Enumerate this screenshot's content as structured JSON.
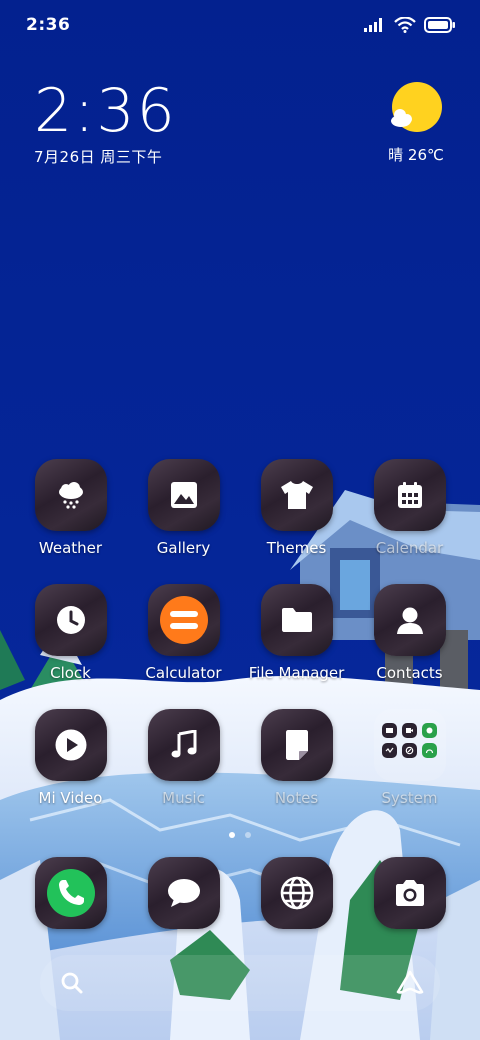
{
  "status_bar": {
    "time": "2:36",
    "icons": [
      "signal-icon",
      "wifi-icon",
      "battery-icon"
    ]
  },
  "clock_widget": {
    "time": "2:36",
    "date": "7月26日 周三下午"
  },
  "weather_widget": {
    "icon": "sun-cloud-icon",
    "text": "晴 26℃",
    "sun_color": "#ffd21f"
  },
  "apps": [
    {
      "label": "Weather",
      "icon": "weather-snow-icon"
    },
    {
      "label": "Gallery",
      "icon": "gallery-icon"
    },
    {
      "label": "Themes",
      "icon": "tshirt-icon"
    },
    {
      "label": "Calendar",
      "icon": "calendar-icon"
    },
    {
      "label": "Clock",
      "icon": "clock-icon"
    },
    {
      "label": "Calculator",
      "icon": "calculator-icon",
      "accent": "#ff7a1a"
    },
    {
      "label": "File Manager",
      "icon": "folder-icon"
    },
    {
      "label": "Contacts",
      "icon": "person-icon"
    },
    {
      "label": "Mi Video",
      "icon": "play-icon"
    },
    {
      "label": "Music",
      "icon": "music-note-icon"
    },
    {
      "label": "Notes",
      "icon": "note-icon"
    },
    {
      "label": "System",
      "icon": "folder-system-icon"
    }
  ],
  "pager": {
    "pages": 2,
    "current": 1
  },
  "dock": [
    {
      "icon": "phone-icon",
      "accent": "#22c25a"
    },
    {
      "icon": "message-icon"
    },
    {
      "icon": "browser-icon"
    },
    {
      "icon": "camera-icon"
    }
  ],
  "search_bar": {
    "left_icon": "search-icon",
    "right_icon": "assistant-icon"
  }
}
